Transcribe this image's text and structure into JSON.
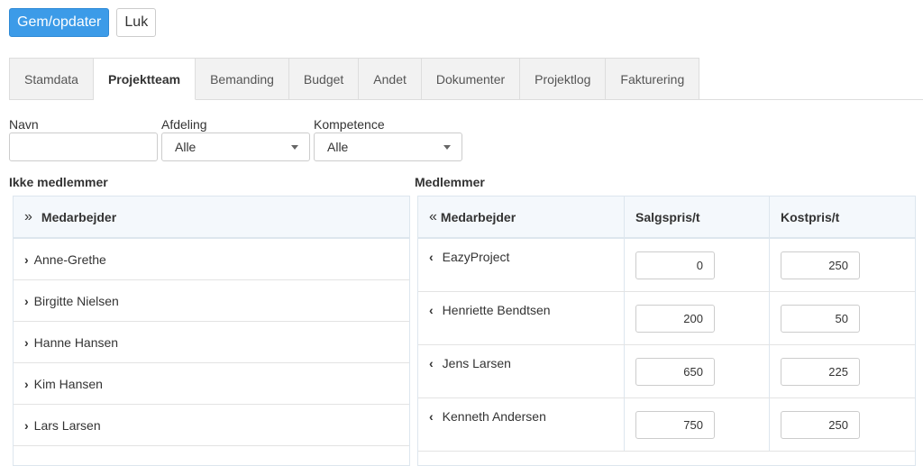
{
  "toolbar": {
    "save_label": "Gem/opdater",
    "close_label": "Luk"
  },
  "tabs": [
    {
      "label": "Stamdata"
    },
    {
      "label": "Projektteam",
      "active": true
    },
    {
      "label": "Bemanding"
    },
    {
      "label": "Budget"
    },
    {
      "label": "Andet"
    },
    {
      "label": "Dokumenter"
    },
    {
      "label": "Projektlog"
    },
    {
      "label": "Fakturering"
    }
  ],
  "filters": {
    "name": {
      "label": "Navn",
      "value": ""
    },
    "department": {
      "label": "Afdeling",
      "value": "Alle"
    },
    "competence": {
      "label": "Kompetence",
      "value": "Alle"
    }
  },
  "non_members": {
    "title": "Ikke medlemmer",
    "header": "Medarbejder",
    "header_icon": "»",
    "items": [
      {
        "name": "Anne-Grethe"
      },
      {
        "name": "Birgitte Nielsen"
      },
      {
        "name": "Hanne Hansen"
      },
      {
        "name": "Kim Hansen"
      },
      {
        "name": "Lars Larsen"
      }
    ]
  },
  "members": {
    "title": "Medlemmer",
    "header_icon": "«",
    "columns": [
      "Medarbejder",
      "Salgspris/t",
      "Kostpris/t"
    ],
    "rows": [
      {
        "name": "EazyProject",
        "sales": "0",
        "cost": "250"
      },
      {
        "name": "Henriette Bendtsen",
        "sales": "200",
        "cost": "50"
      },
      {
        "name": "Jens Larsen",
        "sales": "650",
        "cost": "225"
      },
      {
        "name": "Kenneth Andersen",
        "sales": "750",
        "cost": "250"
      }
    ]
  },
  "colors": {
    "primary": "#3c9be8",
    "header_bg": "#f4f8fc"
  }
}
